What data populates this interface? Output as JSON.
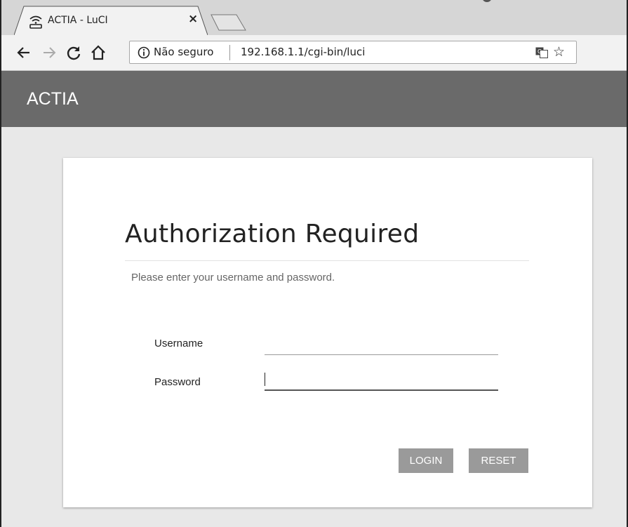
{
  "browser": {
    "tab": {
      "title": "ACTIA - LuCI",
      "close": "×"
    },
    "omnibox": {
      "security_label": "Não seguro",
      "url": "192.168.1.1/cgi-bin/luci"
    }
  },
  "page": {
    "brand": "ACTIA",
    "form": {
      "title": "Authorization Required",
      "subtitle": "Please enter your username and password.",
      "username_label": "Username",
      "password_label": "Password",
      "username_value": "",
      "password_value": "",
      "login_label": "LOGIN",
      "reset_label": "RESET"
    }
  },
  "colors": {
    "header_bg": "#6a6a6a",
    "page_bg": "#e8e8e8",
    "button_bg": "#9a9a9a"
  },
  "icons": [
    "wifi-router-icon",
    "close-icon",
    "back-arrow-icon",
    "forward-arrow-icon",
    "reload-icon",
    "home-icon",
    "info-icon",
    "translate-icon",
    "star-icon",
    "extension-icon",
    "menu-icon"
  ]
}
